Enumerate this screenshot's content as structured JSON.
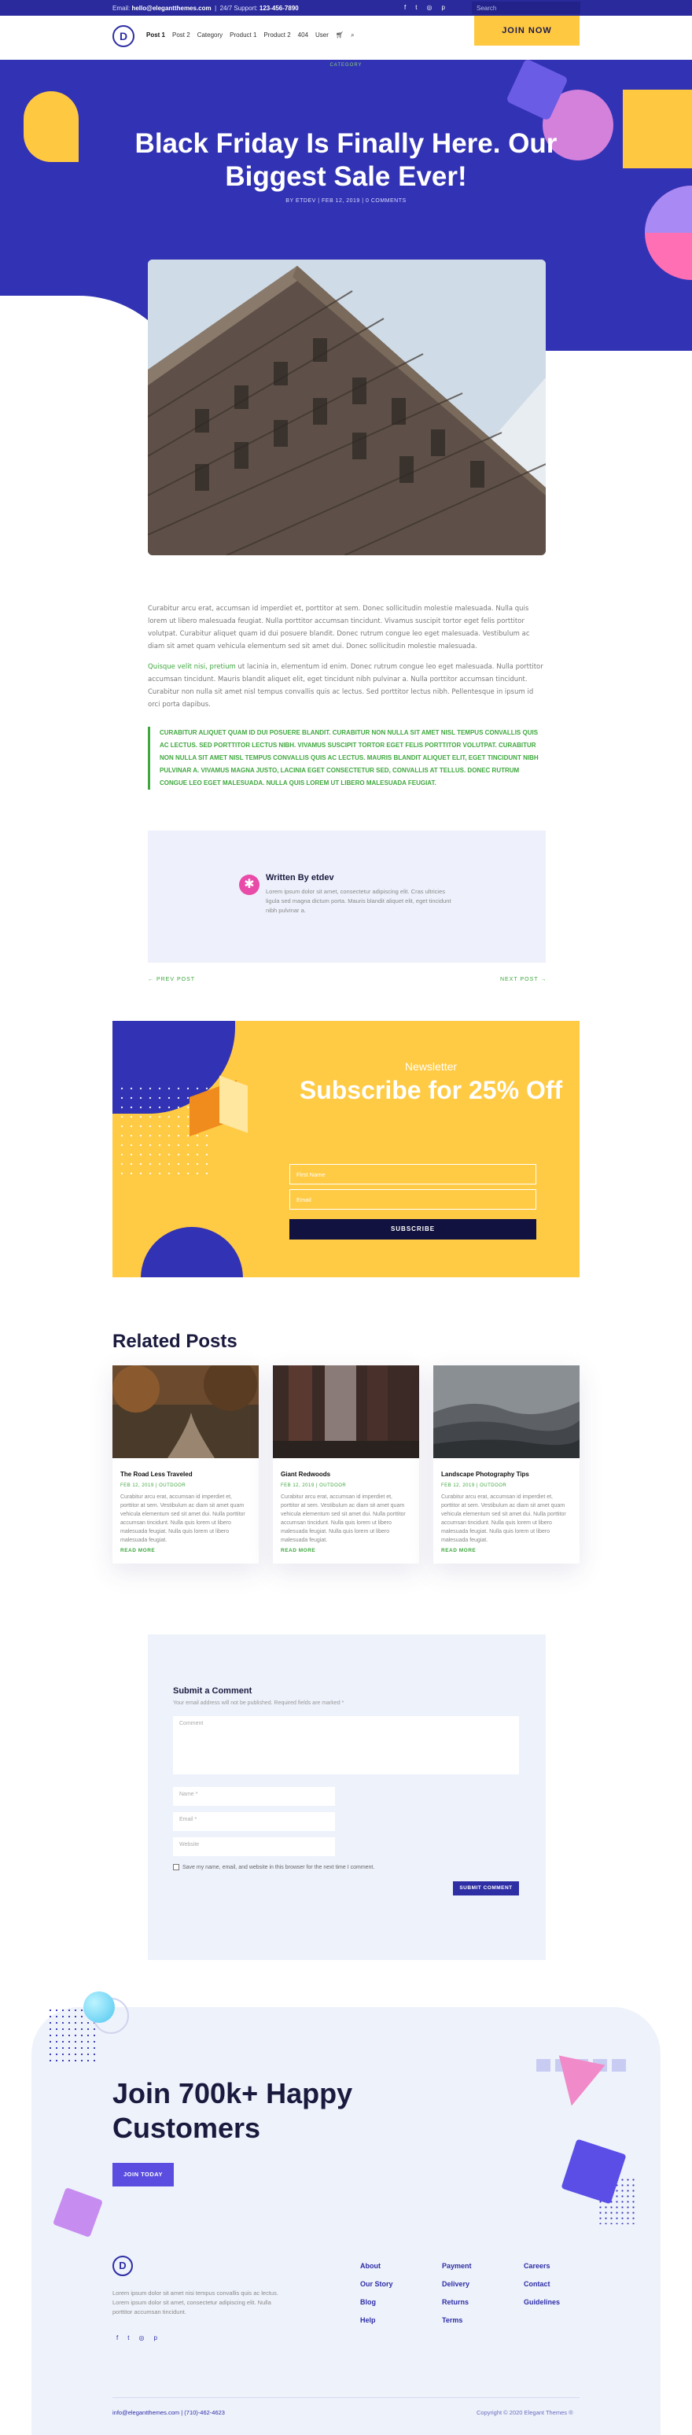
{
  "topbar": {
    "email_prefix": "Email:",
    "email": "hello@elegantthemes.com",
    "support_prefix": "24/7 Support:",
    "support_phone": "123-456-7890",
    "social_icons": [
      "facebook-icon",
      "twitter-icon",
      "instagram-icon",
      "pinterest-icon"
    ],
    "search_placeholder": "Search"
  },
  "header": {
    "logo": "D",
    "nav": [
      "Post 1",
      "Post 2",
      "Category",
      "Product 1",
      "Product 2",
      "404",
      "User"
    ],
    "join_label": "JOIN NOW"
  },
  "hero": {
    "category": "CATEGORY",
    "title": "Black Friday Is Finally Here. Our Biggest Sale Ever!",
    "meta": "BY ETDEV | FEB 12, 2019 | 0 COMMENTS"
  },
  "article": {
    "p1": "Curabitur arcu erat, accumsan id imperdiet et, porttitor at sem. Donec sollicitudin molestie malesuada. Nulla quis lorem ut libero malesuada feugiat. Nulla porttitor accumsan tincidunt. Vivamus suscipit tortor eget felis porttitor volutpat. Curabitur aliquet quam id dui posuere blandit. Donec rutrum congue leo eget malesuada. Vestibulum ac diam sit amet quam vehicula elementum sed sit amet dui. Donec sollicitudin molestie malesuada.",
    "p2_highlight": "Quisque velit nisi, pretium",
    "p2_rest": " ut lacinia in, elementum id enim. Donec rutrum congue leo eget malesuada. Nulla porttitor accumsan tincidunt. Mauris blandit aliquet elit, eget tincidunt nibh pulvinar a. Nulla porttitor accumsan tincidunt. Curabitur non nulla sit amet nisl tempus convallis quis ac lectus. Sed porttitor lectus nibh. Pellentesque in ipsum id orci porta dapibus.",
    "quote": "Curabitur aliquet quam id dui posuere blandit. Curabitur non nulla sit amet nisl tempus convallis quis ac lectus. Sed porttitor lectus nibh. Vivamus suscipit tortor eget felis porttitor volutpat. Curabitur non nulla sit amet nisl tempus convallis quis ac lectus. Mauris blandit aliquet elit, eget tincidunt nibh pulvinar a. Vivamus magna justo, lacinia eget consectetur sed, convallis at tellus. Donec rutrum congue leo eget malesuada. Nulla quis lorem ut libero malesuada feugiat."
  },
  "author": {
    "name": "Written By etdev",
    "desc": "Lorem ipsum dolor sit amet, consectetur adipiscing elit. Cras ultricies ligula sed magna dictum porta. Mauris blandit aliquet elit, eget tincidunt nibh pulvinar a."
  },
  "post_nav": {
    "prev": "← PREV POST",
    "next": "NEXT POST →"
  },
  "newsletter": {
    "label": "Newsletter",
    "title": "Subscribe for 25% Off",
    "first_name_placeholder": "First Name",
    "email_placeholder": "Email",
    "button": "SUBSCRIBE"
  },
  "related": {
    "title": "Related Posts",
    "posts": [
      {
        "title": "The Road Less Traveled",
        "meta": "FEB 12, 2019 | OUTDOOR",
        "excerpt": "Curabitur arcu erat, accumsan id imperdiet et, porttitor at sem. Vestibulum ac diam sit amet quam vehicula elementum sed sit amet dui. Nulla porttitor accumsan tincidunt. Nulla quis lorem ut libero malesuada feugiat. Nulla quis lorem ut libero malesuada feugiat.",
        "read_more": "READ MORE"
      },
      {
        "title": "Giant Redwoods",
        "meta": "FEB 12, 2019 | OUTDOOR",
        "excerpt": "Curabitur arcu erat, accumsan id imperdiet et, porttitor at sem. Vestibulum ac diam sit amet quam vehicula elementum sed sit amet dui. Nulla porttitor accumsan tincidunt. Nulla quis lorem ut libero malesuada feugiat. Nulla quis lorem ut libero malesuada feugiat.",
        "read_more": "READ MORE"
      },
      {
        "title": "Landscape Photography Tips",
        "meta": "FEB 12, 2019 | OUTDOOR",
        "excerpt": "Curabitur arcu erat, accumsan id imperdiet et, porttitor at sem. Vestibulum ac diam sit amet quam vehicula elementum sed sit amet dui. Nulla porttitor accumsan tincidunt. Nulla quis lorem ut libero malesuada feugiat. Nulla quis lorem ut libero malesuada feugiat.",
        "read_more": "READ MORE"
      }
    ]
  },
  "comment": {
    "title": "Submit a Comment",
    "subtitle": "Your email address will not be published. Required fields are marked *",
    "comment_placeholder": "Comment",
    "name_placeholder": "Name *",
    "email_placeholder": "Email *",
    "website_placeholder": "Website",
    "checkbox_label": "Save my name, email, and website in this browser for the next time I comment.",
    "submit": "SUBMIT COMMENT"
  },
  "footer": {
    "title": "Join 700k+ Happy Customers",
    "join_label": "JOIN TODAY",
    "logo": "D",
    "desc": "Lorem ipsum dolor sit amet nisi tempus convallis quis ac lectus. Lorem ipsum dolor sit amet, consectetur adipiscing elit. Nulla porttitor accumsan tincidunt.",
    "social_icons": [
      "facebook-icon",
      "twitter-icon",
      "instagram-icon",
      "pinterest-icon"
    ],
    "col1": [
      "About",
      "Our Story",
      "Blog",
      "Help"
    ],
    "col2": [
      "Payment",
      "Delivery",
      "Returns",
      "Terms"
    ],
    "col3": [
      "Careers",
      "Contact",
      "Guidelines"
    ],
    "bottom_left": "info@elegantthemes.com  |  (710)-462-4623",
    "bottom_right": "Copyright © 2020 Elegant Themes ®"
  }
}
